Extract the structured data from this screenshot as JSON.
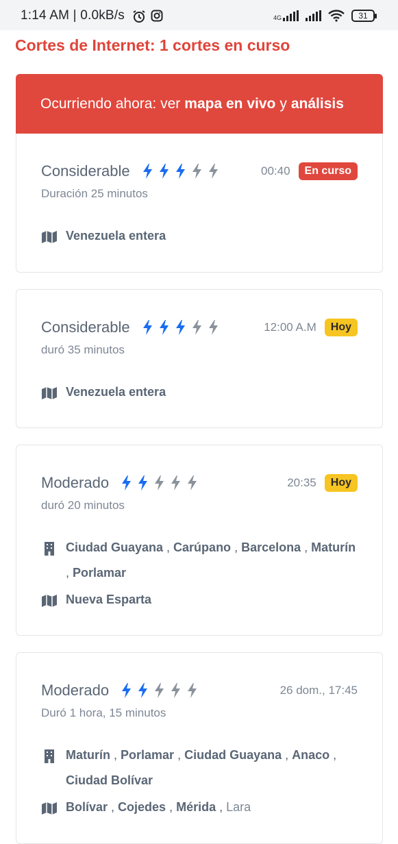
{
  "status_bar": {
    "time": "1:14 AM | 0.0kB/s",
    "network_type": "4G",
    "battery": "31",
    "icons": [
      "alarm-icon",
      "instagram-icon",
      "signal-icon",
      "wifi-icon",
      "battery-icon"
    ]
  },
  "page_title": "Cortes de Internet: 1 cortes en curso",
  "banner": {
    "prefix": "Ocurriendo ahora: ver",
    "link_map": "mapa en vivo",
    "connector": "y",
    "link_analysis": "análisis"
  },
  "colors": {
    "accent_red": "#e0473d",
    "bolt_active": "#1a6cf0",
    "bolt_inactive": "#8a929c",
    "badge_yellow": "#f7c522"
  },
  "outages": [
    {
      "severity": "Considerable",
      "bolts_active": 3,
      "time": "00:40",
      "badge": "En curso",
      "duration": "Duración 25 minutos",
      "regions": "Venezuela entera"
    },
    {
      "severity": "Considerable",
      "bolts_active": 3,
      "time": "12:00 A.M",
      "badge": "Hoy",
      "duration": "duró 35 minutos",
      "regions": "Venezuela entera"
    },
    {
      "severity": "Moderado",
      "bolts_active": 2,
      "time": "20:35",
      "badge": "Hoy",
      "duration": "duró 20 minutos",
      "cities": [
        "Ciudad Guayana",
        "Carúpano",
        "Barcelona",
        "Maturín",
        "Porlamar"
      ],
      "regions": "Nueva Esparta"
    },
    {
      "severity": "Moderado",
      "bolts_active": 2,
      "time": "26 dom., 17:45",
      "duration": "Duró 1 hora, 15 minutos",
      "cities": [
        "Maturín",
        "Porlamar",
        "Ciudad Guayana",
        "Anaco",
        "Ciudad Bolívar"
      ],
      "regions_list": [
        "Bolívar",
        "Cojedes",
        "Mérida"
      ],
      "regions_extra": "Lara"
    }
  ]
}
